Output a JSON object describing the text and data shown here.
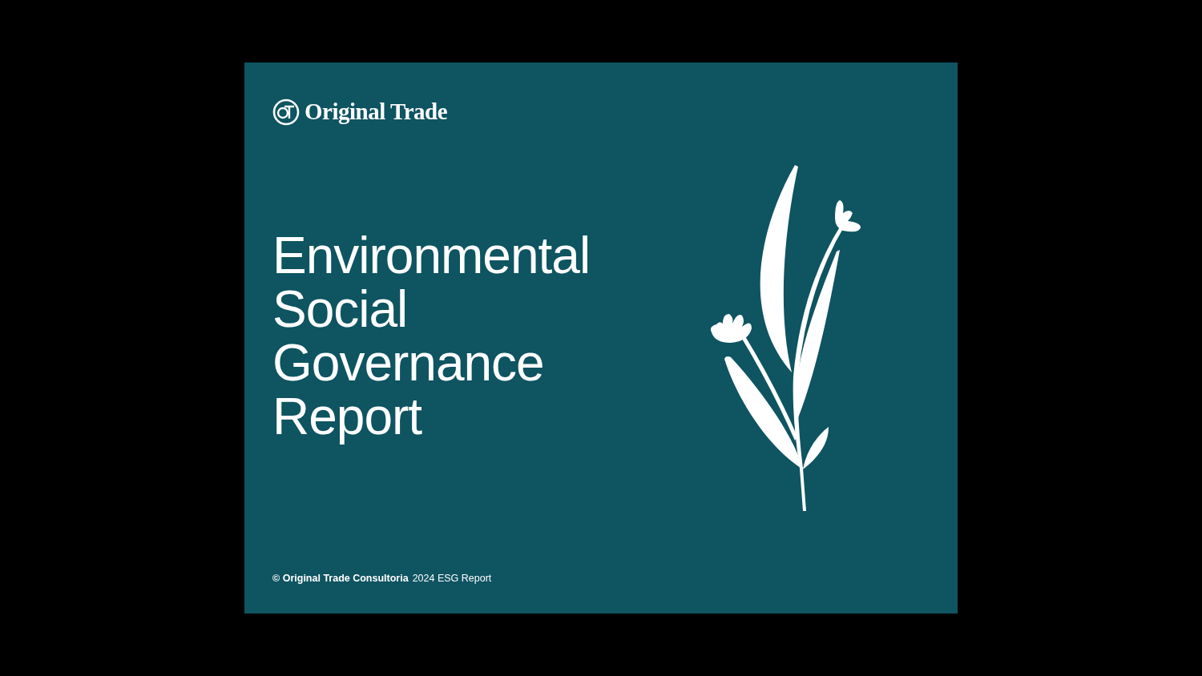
{
  "slide": {
    "brand": "Original Trade",
    "title_lines": [
      "Environmental",
      "Social",
      "Governance",
      "Report"
    ],
    "footer": {
      "owner": "© Original Trade Consultoria",
      "label": "2024 ESG Report"
    }
  }
}
